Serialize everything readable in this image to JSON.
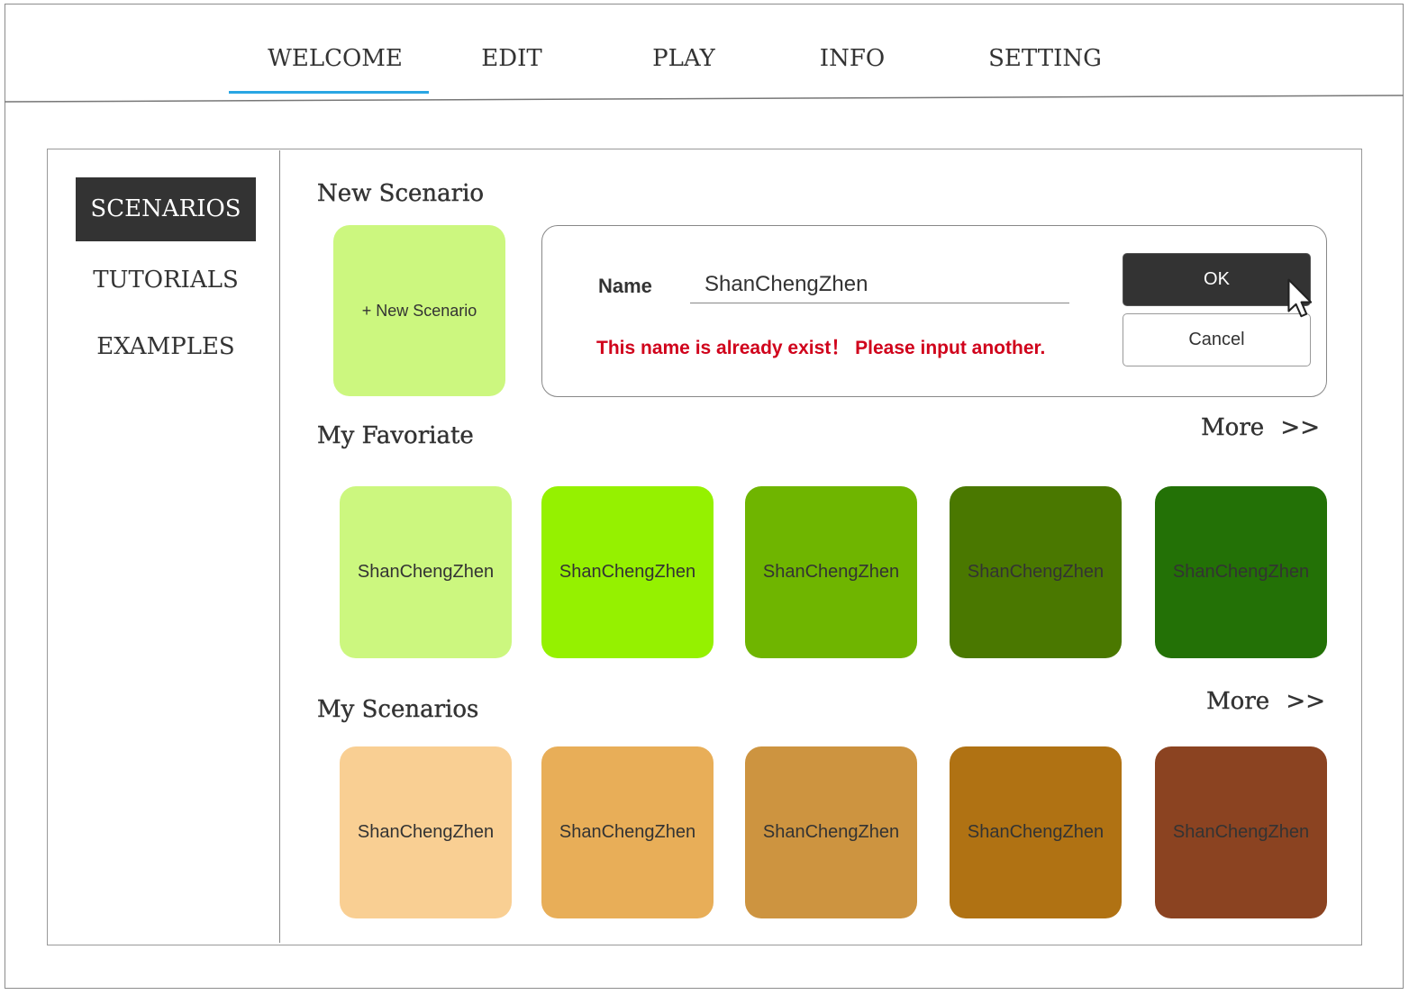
{
  "theme": {
    "accent": "#29a6e3",
    "dark": "#333333",
    "error": "#d0021b"
  },
  "nav": {
    "tabs": [
      {
        "label": "WELCOME",
        "active": true
      },
      {
        "label": "EDIT",
        "active": false
      },
      {
        "label": "PLAY",
        "active": false
      },
      {
        "label": "INFO",
        "active": false
      },
      {
        "label": "SETTING",
        "active": false
      }
    ]
  },
  "sidebar": {
    "items": [
      {
        "label": "SCENARIOS",
        "active": true
      },
      {
        "label": "TUTORIALS",
        "active": false
      },
      {
        "label": "EXAMPLES",
        "active": false
      }
    ]
  },
  "new_scenario": {
    "heading": "New Scenario",
    "tile_label": "+ New Scenario",
    "tile_color": "#ccf77f"
  },
  "dialog": {
    "name_label": "Name",
    "name_value": "ShanChengZhen",
    "error_message": "This name is already exist！ Please input another.",
    "ok_label": "OK",
    "cancel_label": "Cancel",
    "cursor_icon": "mouse-cursor-icon"
  },
  "favorite": {
    "heading": "My Favoriate",
    "more_label": "More >>",
    "items": [
      {
        "label": "ShanChengZhen",
        "color": "#ccf77f"
      },
      {
        "label": "ShanChengZhen",
        "color": "#95f100"
      },
      {
        "label": "ShanChengZhen",
        "color": "#6fb500"
      },
      {
        "label": "ShanChengZhen",
        "color": "#4a7800"
      },
      {
        "label": "ShanChengZhen",
        "color": "#237106"
      }
    ]
  },
  "scenarios": {
    "heading": "My Scenarios",
    "more_label": "More >>",
    "items": [
      {
        "label": "ShanChengZhen",
        "color": "#f9cf93"
      },
      {
        "label": "ShanChengZhen",
        "color": "#e8ae58"
      },
      {
        "label": "ShanChengZhen",
        "color": "#cd9440"
      },
      {
        "label": "ShanChengZhen",
        "color": "#b07213"
      },
      {
        "label": "ShanChengZhen",
        "color": "#8b4321"
      }
    ]
  }
}
